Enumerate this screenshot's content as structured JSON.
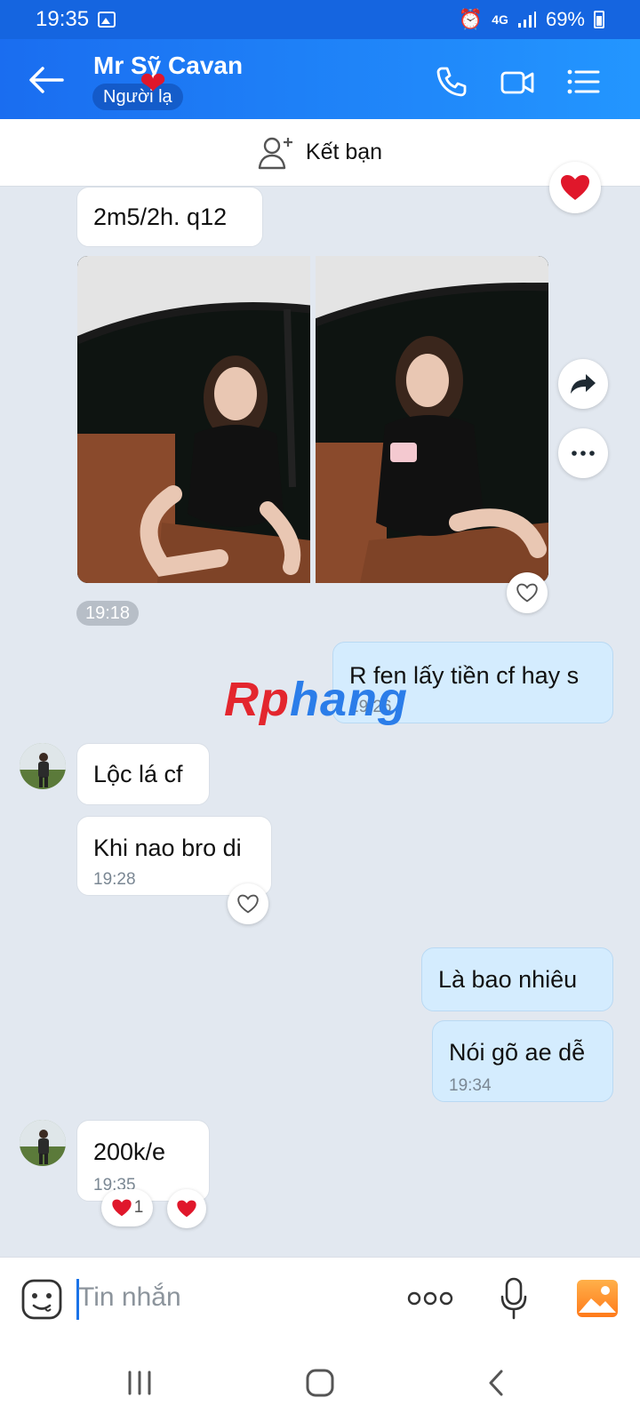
{
  "status_bar": {
    "time": "19:35",
    "network": "4G",
    "battery": "69%"
  },
  "header": {
    "contact_name": "Mr Sỹ Cavan",
    "badge": "Người lạ"
  },
  "add_friend": {
    "label": "Kết bạn"
  },
  "messages": {
    "m1": {
      "text": "2m5/2h. q12"
    },
    "photo_time": "19:18",
    "m2": {
      "text": "R fen lấy tiền cf hay s",
      "time": "19:26"
    },
    "m3": {
      "text": "Lộc lá cf"
    },
    "m4": {
      "text": "Khi nao bro di",
      "time": "19:28"
    },
    "m5": {
      "text": "Là bao nhiêu"
    },
    "m6": {
      "text": "Nói gõ ae dễ",
      "time": "19:34"
    },
    "m7": {
      "text": "200k/e",
      "time": "19:35",
      "reaction_count": "1"
    }
  },
  "watermark": {
    "part1": "Rp",
    "part2": "hang"
  },
  "input": {
    "placeholder": "Tin nhắn"
  },
  "colors": {
    "header": "#1a6df0",
    "my_bubble": "#d4ecfe",
    "heart": "#e0172b",
    "background": "#e2e8f0"
  }
}
